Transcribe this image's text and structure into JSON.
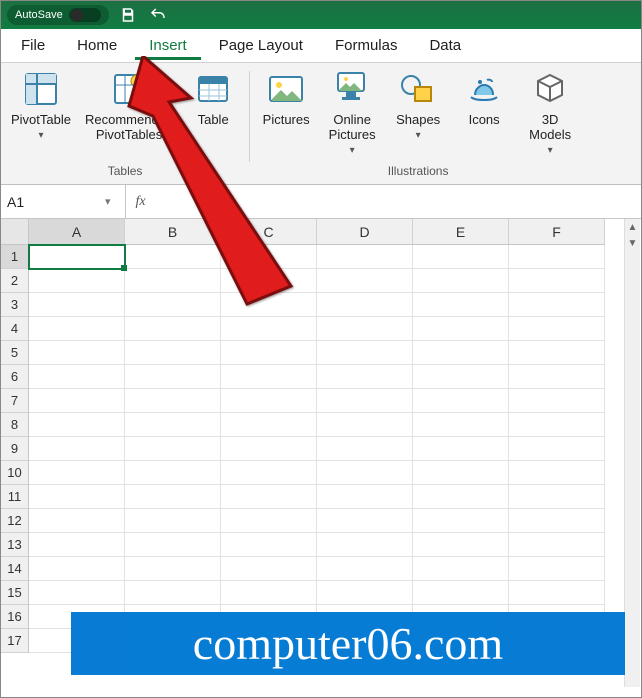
{
  "title_bar": {
    "autosave_label": "AutoSave",
    "autosave_state": "Off"
  },
  "menu": {
    "tabs": [
      "File",
      "Home",
      "Insert",
      "Page Layout",
      "Formulas",
      "Data"
    ],
    "active_tab": "Insert"
  },
  "ribbon": {
    "groups": [
      {
        "label": "Tables",
        "items": [
          {
            "name": "pivottable",
            "label": "PivotTable",
            "caret": true
          },
          {
            "name": "recommended-pivottables",
            "label": "Recommended\nPivotTables"
          },
          {
            "name": "table",
            "label": "Table"
          }
        ]
      },
      {
        "label": "Illustrations",
        "items": [
          {
            "name": "pictures",
            "label": "Pictures"
          },
          {
            "name": "online-pictures",
            "label": "Online\nPictures",
            "caret": true
          },
          {
            "name": "shapes",
            "label": "Shapes",
            "caret": true
          },
          {
            "name": "icons",
            "label": "Icons"
          },
          {
            "name": "3d-models",
            "label": "3D\nModels",
            "caret": true
          }
        ]
      }
    ]
  },
  "formula_bar": {
    "name_box": "A1",
    "fx": "fx",
    "value": ""
  },
  "grid": {
    "columns": [
      "A",
      "B",
      "C",
      "D",
      "E",
      "F"
    ],
    "rows": [
      1,
      2,
      3,
      4,
      5,
      6,
      7,
      8,
      9,
      10,
      11,
      12,
      13,
      14,
      15,
      16,
      17
    ],
    "selected_cell": "A1"
  },
  "watermark": "computer06.com"
}
